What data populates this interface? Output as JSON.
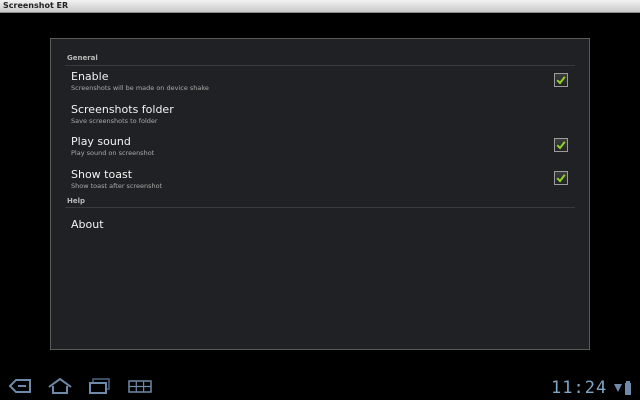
{
  "window": {
    "title": "Screenshot ER"
  },
  "sections": [
    {
      "header": "General",
      "items": [
        {
          "title": "Enable",
          "summary": "Screenshots will be made on device shake",
          "checked": true
        },
        {
          "title": "Screenshots folder",
          "summary": "Save screenshots to folder"
        },
        {
          "title": "Play sound",
          "summary": "Play sound on screenshot",
          "checked": true
        },
        {
          "title": "Show toast",
          "summary": "Show toast after screenshot",
          "checked": true
        }
      ]
    },
    {
      "header": "Help",
      "items": [
        {
          "title": "About"
        }
      ]
    }
  ],
  "status": {
    "time": "11:24"
  },
  "nav": {
    "icons": [
      "back-icon",
      "home-icon",
      "recent-apps-icon",
      "screenshot-menu-icon"
    ]
  },
  "colors": {
    "checkmark": "#8fd42a",
    "clock": "#7ea6c5",
    "panel": "#202124"
  }
}
